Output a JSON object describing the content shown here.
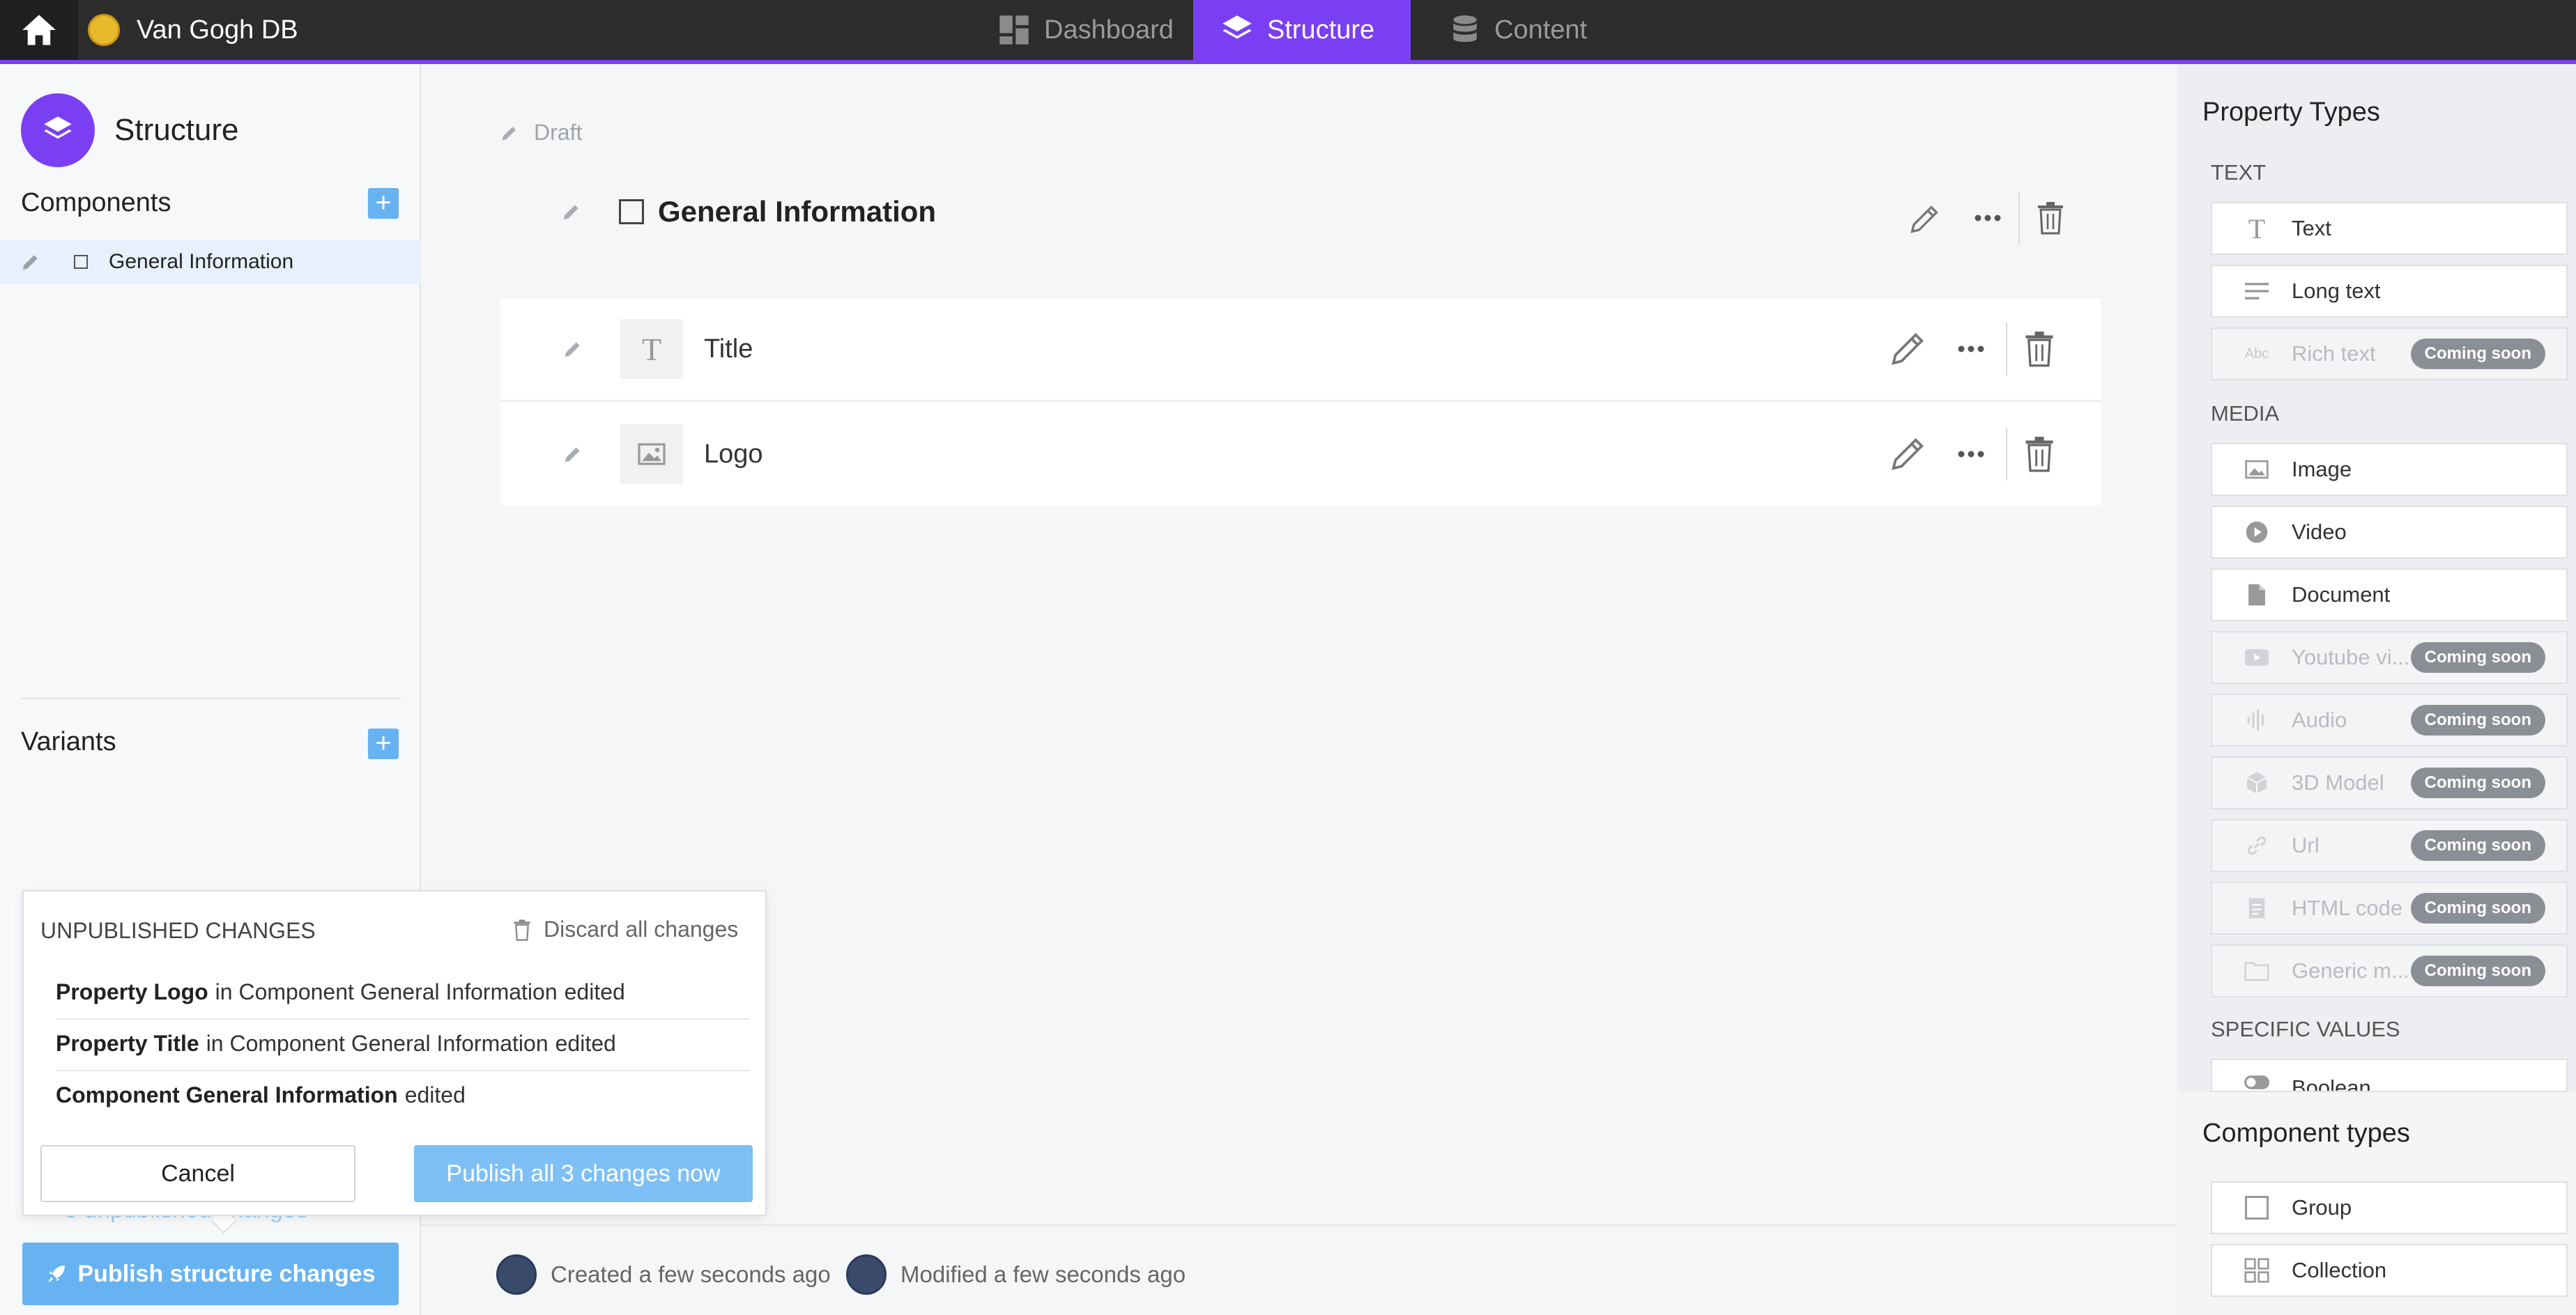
{
  "topbar": {
    "brand_name": "Van Gogh DB",
    "tabs": [
      {
        "label": "Dashboard",
        "icon": "dashboard-icon"
      },
      {
        "label": "Structure",
        "icon": "layers-icon",
        "active": true
      },
      {
        "label": "Content",
        "icon": "database-icon"
      }
    ],
    "accent_color": "#7a3ff2"
  },
  "sidebar": {
    "title": "Structure",
    "components_label": "Components",
    "components": [
      {
        "label": "General Information"
      }
    ],
    "variants_label": "Variants"
  },
  "popover": {
    "title": "UNPUBLISHED CHANGES",
    "discard_label": "Discard all changes",
    "changes": [
      {
        "bold": "Property Logo",
        "middle": "in Component General Information",
        "status": "edited"
      },
      {
        "bold": "Property Title",
        "middle": "in Component General Information",
        "status": "edited"
      },
      {
        "bold": "Component General Information",
        "middle": "",
        "status": "edited"
      }
    ],
    "cancel_label": "Cancel",
    "publish_now_label": "Publish all 3 changes now"
  },
  "sidebar_footer": {
    "hidden_link": "3 unpublished changes",
    "publish_label": "Publish structure changes"
  },
  "main": {
    "status": "Draft",
    "component_title": "General Information",
    "properties": [
      {
        "label": "Title",
        "icon": "text-type-icon"
      },
      {
        "label": "Logo",
        "icon": "image-type-icon"
      }
    ],
    "created": "Created a few seconds ago",
    "modified": "Modified a few seconds ago"
  },
  "property_types": {
    "title": "Property Types",
    "coming_soon": "Coming soon",
    "categories": [
      {
        "name": "TEXT",
        "items": [
          {
            "label": "Text",
            "icon": "text-icon",
            "disabled": false
          },
          {
            "label": "Long text",
            "icon": "long-text-icon",
            "disabled": false
          },
          {
            "label": "Rich text",
            "icon": "rich-text-icon",
            "disabled": true
          }
        ]
      },
      {
        "name": "MEDIA",
        "items": [
          {
            "label": "Image",
            "icon": "image-icon",
            "disabled": false
          },
          {
            "label": "Video",
            "icon": "video-icon",
            "disabled": false
          },
          {
            "label": "Document",
            "icon": "document-icon",
            "disabled": false
          },
          {
            "label": "Youtube vi...",
            "icon": "youtube-icon",
            "disabled": true
          },
          {
            "label": "Audio",
            "icon": "audio-icon",
            "disabled": true
          },
          {
            "label": "3D Model",
            "icon": "cube-icon",
            "disabled": true
          },
          {
            "label": "Url",
            "icon": "link-icon",
            "disabled": true
          },
          {
            "label": "HTML code",
            "icon": "html-icon",
            "disabled": true
          },
          {
            "label": "Generic m...",
            "icon": "folder-icon",
            "disabled": true
          }
        ]
      },
      {
        "name": "SPECIFIC VALUES",
        "items": [
          {
            "label": "Boolean",
            "icon": "toggle-icon",
            "disabled": false
          }
        ]
      }
    ]
  },
  "component_types": {
    "title": "Component types",
    "items": [
      {
        "label": "Group",
        "icon": "group-icon"
      },
      {
        "label": "Collection",
        "icon": "collection-icon"
      }
    ]
  }
}
